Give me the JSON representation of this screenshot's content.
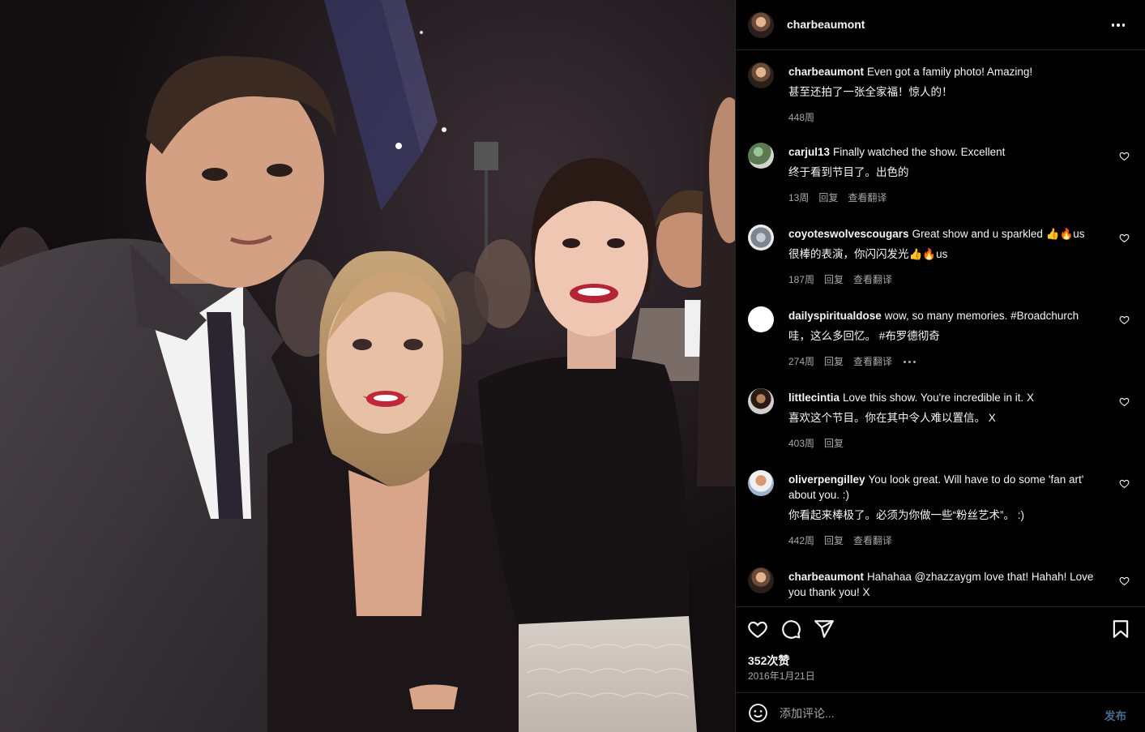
{
  "post": {
    "username": "charbeaumont",
    "likes": "352次赞",
    "date": "2016年1月21日",
    "comment_placeholder": "添加评论...",
    "post_label": "发布"
  },
  "caption": {
    "username": "charbeaumont",
    "text": "Even got a family photo! Amazing!",
    "translation": "甚至还拍了一张全家福！惊人的！",
    "time": "448周"
  },
  "comments": [
    {
      "username": "carjul13",
      "text": "Finally watched the show. Excellent",
      "translation": "终于看到节目了。出色的",
      "time": "13周",
      "reply": "回复",
      "see_translation": "查看翻译"
    },
    {
      "username": "coyoteswolvescougars",
      "text": "Great show and u sparkled 👍🔥us",
      "translation": "很棒的表演，你闪闪发光👍🔥us",
      "time": "187周",
      "reply": "回复",
      "see_translation": "查看翻译"
    },
    {
      "username": "dailyspiritualdose",
      "text": "wow, so many memories. #Broadchurch",
      "translation": "哇，这么多回忆。 #布罗德彻奇",
      "time": "274周",
      "reply": "回复",
      "see_translation": "查看翻译"
    },
    {
      "username": "littlecintia",
      "text": "Love this show. You're incredible in it. X",
      "translation": "喜欢这个节目。你在其中令人难以置信。 X",
      "time": "403周",
      "reply": "回复"
    },
    {
      "username": "oliverpengilley",
      "text": "You look great. Will have to do some 'fan art' about you. :)",
      "translation": "你看起来棒极了。必须为你做一些“粉丝艺术”。 :)",
      "time": "442周",
      "reply": "回复",
      "see_translation": "查看翻译"
    },
    {
      "username": "charbeaumont",
      "text": "Hahahaa @zhazzaygm love that! Hahah! Love you thank you! X"
    }
  ],
  "colors": {
    "background": "#000000",
    "text": "#f5f5f5",
    "secondary": "#a8a8a8",
    "divider": "#262626",
    "post_button": "#4a6a8f"
  },
  "icons": [
    "more-icon",
    "heart-icon",
    "comment-icon",
    "share-icon",
    "bookmark-icon",
    "emoji-icon"
  ]
}
